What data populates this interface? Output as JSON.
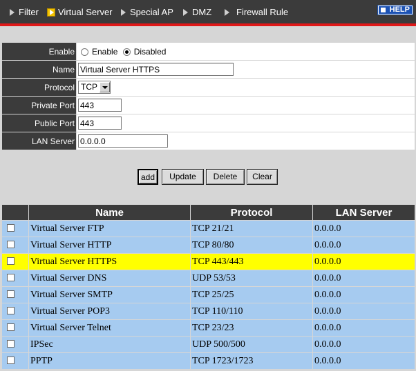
{
  "nav": {
    "items": [
      {
        "label": "Filter",
        "active": false
      },
      {
        "label": "Virtual Server",
        "active": true
      },
      {
        "label": "Special AP",
        "active": false
      },
      {
        "label": "DMZ",
        "active": false
      },
      {
        "label": "Firewall Rule",
        "active": false
      }
    ],
    "help_label": "HELP"
  },
  "form": {
    "enable_label": "Enable",
    "enable_option": "Enable",
    "disabled_option": "Disabled",
    "enable_selected": "Disabled",
    "name_label": "Name",
    "name_value": "Virtual Server HTTPS",
    "protocol_label": "Protocol",
    "protocol_value": "TCP",
    "private_port_label": "Private Port",
    "private_port_value": "443",
    "public_port_label": "Public Port",
    "public_port_value": "443",
    "lan_server_label": "LAN Server",
    "lan_server_value": "0.0.0.0"
  },
  "buttons": {
    "add": "add",
    "update": "Update",
    "delete": "Delete",
    "clear": "Clear"
  },
  "table": {
    "headers": [
      "",
      "Name",
      "Protocol",
      "LAN Server"
    ],
    "rows": [
      {
        "name": "Virtual Server FTP",
        "protocol": "TCP 21/21",
        "lan": "0.0.0.0",
        "highlight": false
      },
      {
        "name": "Virtual Server HTTP",
        "protocol": "TCP 80/80",
        "lan": "0.0.0.0",
        "highlight": false
      },
      {
        "name": "Virtual Server HTTPS",
        "protocol": "TCP 443/443",
        "lan": "0.0.0.0",
        "highlight": true
      },
      {
        "name": "Virtual Server DNS",
        "protocol": "UDP 53/53",
        "lan": "0.0.0.0",
        "highlight": false
      },
      {
        "name": "Virtual Server SMTP",
        "protocol": "TCP 25/25",
        "lan": "0.0.0.0",
        "highlight": false
      },
      {
        "name": "Virtual Server POP3",
        "protocol": "TCP 110/110",
        "lan": "0.0.0.0",
        "highlight": false
      },
      {
        "name": "Virtual Server Telnet",
        "protocol": "TCP 23/23",
        "lan": "0.0.0.0",
        "highlight": false
      },
      {
        "name": "IPSec",
        "protocol": "UDP 500/500",
        "lan": "0.0.0.0",
        "highlight": false
      },
      {
        "name": "PPTP",
        "protocol": "TCP 1723/1723",
        "lan": "0.0.0.0",
        "highlight": false
      }
    ]
  },
  "colors": {
    "nav_bg": "#3b3b3b",
    "nav_underline": "#e01818",
    "row_bg": "#a6cbf0",
    "row_highlight": "#ffff00"
  }
}
